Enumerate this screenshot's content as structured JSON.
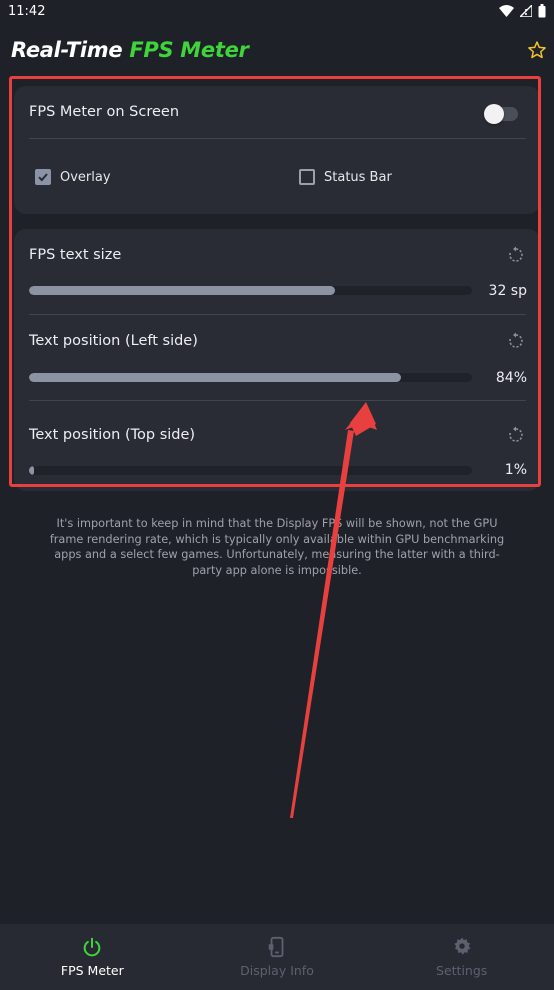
{
  "status_bar": {
    "time": "11:42"
  },
  "header": {
    "title_plain": "Real-Time ",
    "title_accent": "FPS Meter",
    "accent_color": "#3fd43a"
  },
  "settings_card": {
    "fps_meter_label": "FPS Meter on Screen",
    "fps_meter_enabled": false,
    "overlay_label": "Overlay",
    "overlay_checked": true,
    "status_bar_label": "Status Bar",
    "status_bar_checked": false
  },
  "sliders": [
    {
      "label": "FPS text size",
      "value_text": "32 sp",
      "fill_fraction": 0.69
    },
    {
      "label": "Text position (Left side)",
      "value_text": "84%",
      "fill_fraction": 0.84
    },
    {
      "label": "Text position (Top side)",
      "value_text": "1%",
      "fill_fraction": 0.01
    }
  ],
  "note": "It's important to keep in mind that the Display FPS will be shown, not the GPU frame rendering rate, which is typically only available within GPU benchmarking apps and a select few games. Unfortunately, measuring the latter with a third-party app alone is impossible.",
  "nav": {
    "items": [
      {
        "label": "FPS Meter",
        "icon": "power-icon",
        "active": true
      },
      {
        "label": "Display Info",
        "icon": "phone-icon",
        "active": false
      },
      {
        "label": "Settings",
        "icon": "gear-icon",
        "active": false
      }
    ]
  },
  "colors": {
    "background": "#1e2127",
    "card": "#292c35",
    "highlight": "#e8403f",
    "accent": "#3fd43a"
  }
}
